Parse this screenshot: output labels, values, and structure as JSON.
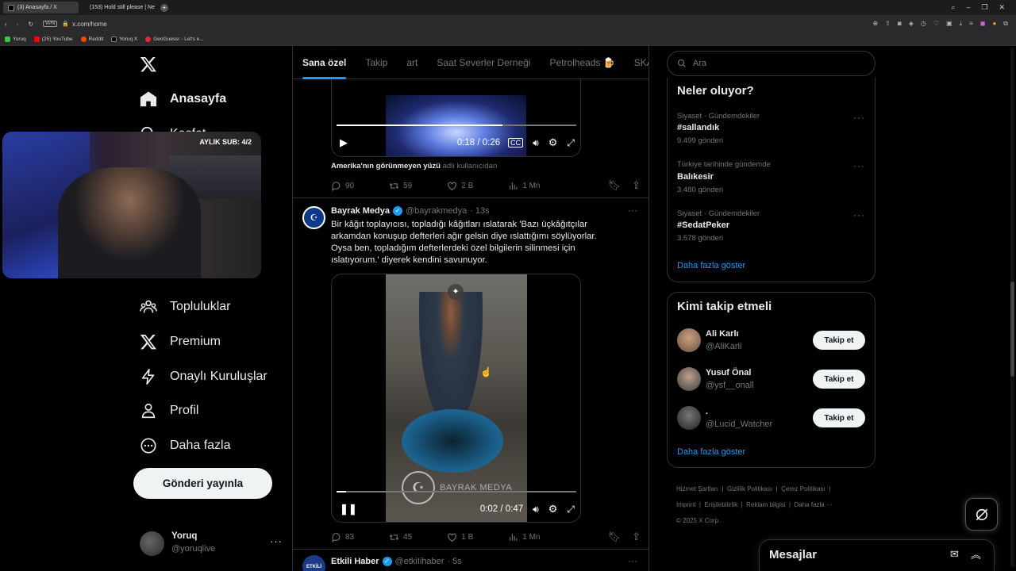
{
  "browser": {
    "tabs": [
      {
        "label": "(3) Anasayfa / X"
      },
      {
        "label": "(153) Hold still please | Ne"
      }
    ],
    "url": "x.com/home",
    "vpn": "VPN",
    "bookmarks": [
      {
        "label": "Yoruq"
      },
      {
        "label": "(25) YouTube"
      },
      {
        "label": "Reddit"
      },
      {
        "label": "Yoruq X"
      },
      {
        "label": "GeoGuessr - Let's e..."
      }
    ]
  },
  "sidebar": {
    "items": [
      {
        "label": "Anasayfa"
      },
      {
        "label": "Keşfet"
      },
      {
        "label": "Topluluklar"
      },
      {
        "label": "Premium"
      },
      {
        "label": "Onaylı Kuruluşlar"
      },
      {
        "label": "Profil"
      },
      {
        "label": "Daha fazla"
      }
    ],
    "post_button": "Gönderi yayınla",
    "account": {
      "name": "Yoruq",
      "handle": "@yoruqlive"
    }
  },
  "webcam": {
    "overlay": "AYLIK SUB: 4/2"
  },
  "feed": {
    "tabs": [
      "Sana özel",
      "Takip",
      "art",
      "Saat Severler Derneği",
      "Petrolheads 🍺",
      "SKA"
    ],
    "tweet1": {
      "video_time": "0:18 / 0:26",
      "attribution_bold": "Amerika'nın görünmeyen yüzü",
      "attribution_rest": "adlı kullanıcıdan",
      "replies": "90",
      "retweets": "59",
      "likes": "2 B",
      "views": "1 Mn"
    },
    "tweet2": {
      "name": "Bayrak Medya",
      "handle": "@bayrakmedya",
      "time": "· 13s",
      "text": "Bir kâğıt toplayıcısı, topladığı kâğıtları ıslatarak 'Bazı üçkâğıtçılar arkamdan konuşup defterleri ağır gelsin diye ıslattığımı söylüyorlar. Oysa ben, topladığım defterlerdeki özel bilgilerin silinmesi için ıslatıyorum.' diyerek kendini savunuyor.",
      "video_time": "0:02 / 0:47",
      "watermark": "BAYRAK MEDYA",
      "replies": "83",
      "retweets": "45",
      "likes": "1 B",
      "views": "1 Mn"
    },
    "tweet3": {
      "name": "Etkili Haber",
      "handle": "@etkiIihaber",
      "time": "· 5s"
    }
  },
  "right": {
    "search_placeholder": "Ara",
    "trends_title": "Neler oluyor?",
    "trends": [
      {
        "meta": "Siyaset · Gündemdekiler",
        "name": "#sallandık",
        "count": "9.499 gönderi"
      },
      {
        "meta": "Türkiye tarihinde gündemde",
        "name": "Balıkesir",
        "count": "3.480 gönderi"
      },
      {
        "meta": "Siyaset · Gündemdekiler",
        "name": "#SedatPeker",
        "count": "3.578 gönderi"
      }
    ],
    "trends_more": "Daha fazla göster",
    "who_title": "Kimi takip etmeli",
    "who": [
      {
        "name": "Ali Karlı",
        "handle": "@AliKarli",
        "button": "Takip et"
      },
      {
        "name": "Yusuf Önal",
        "handle": "@ysf__onall",
        "button": "Takip et"
      },
      {
        "name": ".",
        "handle": "@Lucid_Watcher",
        "button": "Takip et"
      }
    ],
    "who_more": "Daha fazla göster",
    "footer": {
      "links": [
        "Hizmet Şartları",
        "Gizlilik Politikası",
        "Çerez Politikası",
        "Imprint",
        "Erişilebilirlik",
        "Reklam bilgisi",
        "Daha fazla ···"
      ],
      "copyright": "© 2025 X Corp."
    },
    "messages_title": "Mesajlar"
  }
}
